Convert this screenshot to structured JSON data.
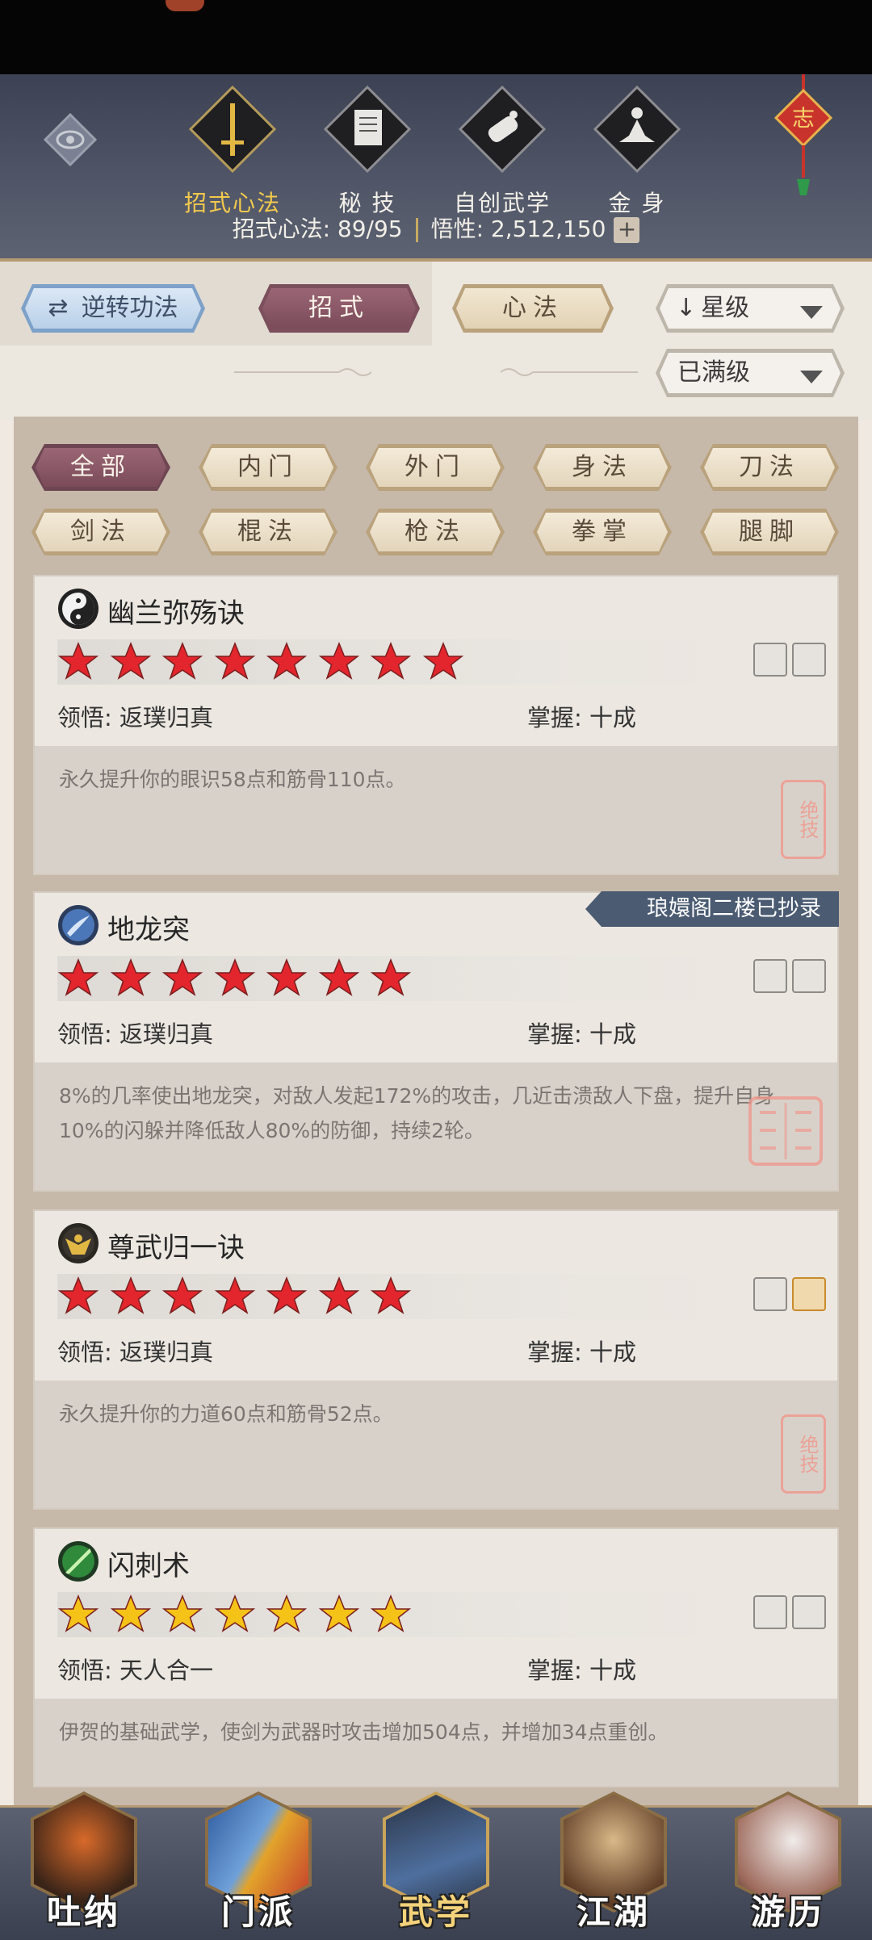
{
  "header": {
    "tabs": [
      {
        "label": "招式心法",
        "icon": "sword-icon",
        "active": true
      },
      {
        "label": "秘 技",
        "icon": "book-icon",
        "active": false
      },
      {
        "label": "自创武学",
        "icon": "scroll-icon",
        "active": false
      },
      {
        "label": "金 身",
        "icon": "meditation-icon",
        "active": false
      }
    ],
    "knot_char": "志",
    "stats": {
      "moves_label": "招式心法: 89/95",
      "insight_label": "悟性: 2,512,150",
      "plus": "+"
    }
  },
  "controls": {
    "reverse_label": "逆转功法",
    "tab_moves": "招式",
    "tab_methods": "心法",
    "sort_label": "星级",
    "filter_label": "已满级"
  },
  "categories": [
    {
      "label": "全部",
      "active": true
    },
    {
      "label": "内门",
      "active": false
    },
    {
      "label": "外门",
      "active": false
    },
    {
      "label": "身法",
      "active": false
    },
    {
      "label": "刀法",
      "active": false
    },
    {
      "label": "剑法",
      "active": false
    },
    {
      "label": "棍法",
      "active": false
    },
    {
      "label": "枪法",
      "active": false
    },
    {
      "label": "拳掌",
      "active": false
    },
    {
      "label": "腿脚",
      "active": false
    }
  ],
  "skills": [
    {
      "name": "幽兰弥殇诀",
      "icon": "yin-yang-icon",
      "stars": 8,
      "star_color": "red",
      "comprehension": "领悟: 返璞归真",
      "mastery": "掌握: 十成",
      "description": "永久提升你的眼识58点和筋骨110点。",
      "ribbon": "",
      "seal": "绝技",
      "badges": [
        "flower-badge-icon",
        "leaf-badge-icon"
      ]
    },
    {
      "name": "地龙突",
      "icon": "dragon-spear-icon",
      "stars": 7,
      "star_color": "red",
      "comprehension": "领悟: 返璞归真",
      "mastery": "掌握: 十成",
      "description": "8%的几率使出地龙突，对敌人发起172%的攻击，几近击溃敌人下盘，提升自身10%的闪躲并降低敌人80%的防御，持续2轮。",
      "ribbon": "琅嬛阁二楼已抄录",
      "seal": "",
      "badges": [
        "spiral-badge-icon",
        "spear-badge-icon"
      ]
    },
    {
      "name": "尊武归一诀",
      "icon": "golden-warrior-icon",
      "stars": 7,
      "star_color": "red",
      "comprehension": "领悟: 返璞归真",
      "mastery": "掌握: 十成",
      "description": "永久提升你的力道60点和筋骨52点。",
      "ribbon": "",
      "seal": "绝技",
      "badges": [
        "fighter-badge-icon",
        "kick-badge-icon"
      ]
    },
    {
      "name": "闪刺术",
      "icon": "green-blade-icon",
      "stars": 7,
      "star_color": "gold",
      "comprehension": "领悟: 天人合一",
      "mastery": "掌握: 十成",
      "description": "伊贺的基础武学，使剑为武器时攻击增加504点，并增加34点重创。",
      "ribbon": "",
      "seal": "",
      "badges": [
        "sword-badge-icon",
        "stance-badge-icon"
      ]
    }
  ],
  "bottom_nav": [
    {
      "label": "吐纳",
      "icon": "monk-icon",
      "active": false
    },
    {
      "label": "门派",
      "icon": "sect-flags-icon",
      "active": false
    },
    {
      "label": "武学",
      "icon": "martial-book-icon",
      "active": true
    },
    {
      "label": "江湖",
      "icon": "straw-hat-icon",
      "active": false
    },
    {
      "label": "游历",
      "icon": "horse-icon",
      "active": false
    }
  ],
  "colors": {
    "header_bg": "#4f5566",
    "active_gold": "#f3c94c",
    "panel": "#c6b9aa",
    "card": "#ece7e1",
    "star_red": "#e3262d",
    "star_gold": "#f5c218",
    "ribbon": "#4a5b72"
  }
}
